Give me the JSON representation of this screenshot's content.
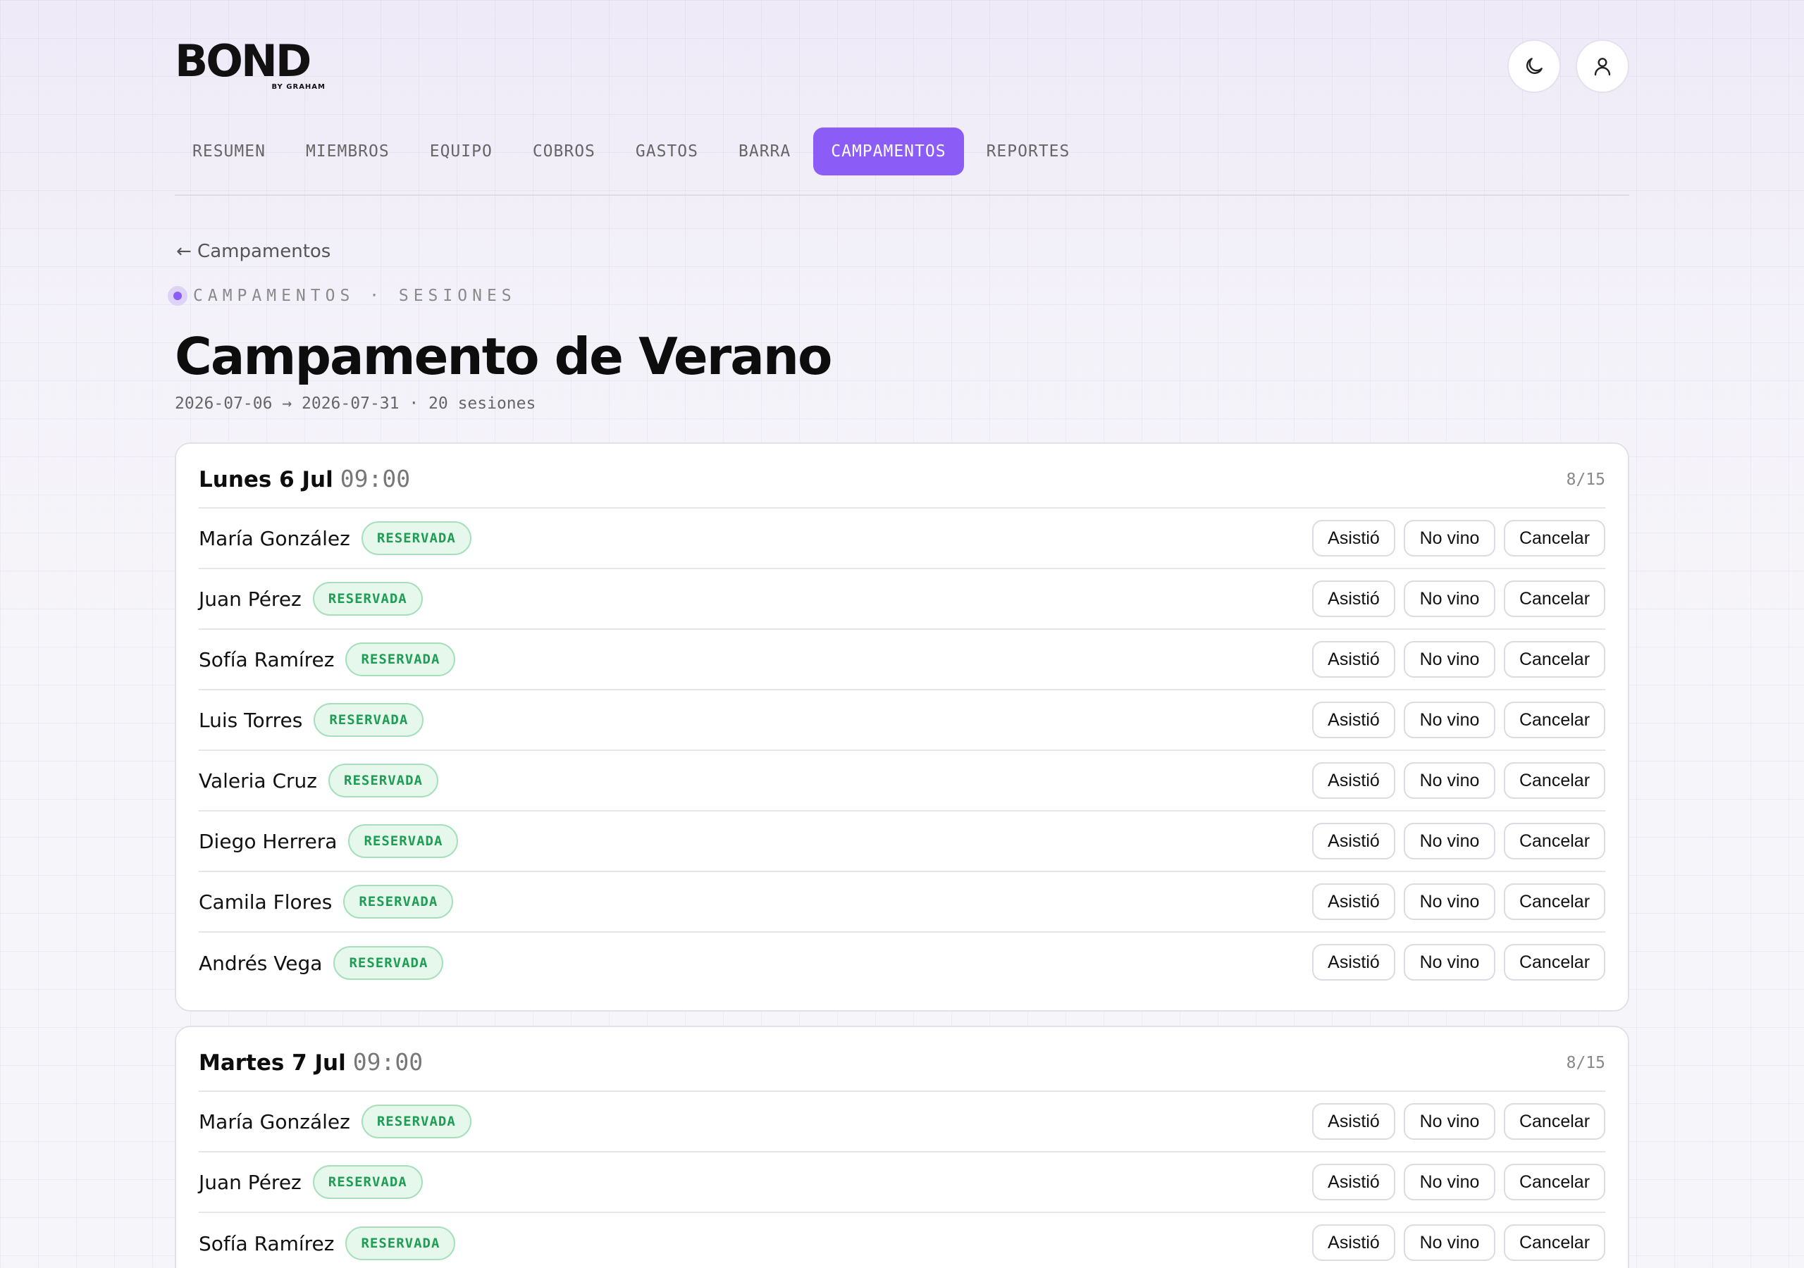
{
  "brand": {
    "logo_text": "BOND",
    "logo_sub": "BY GRAHAM"
  },
  "nav": {
    "tabs": [
      {
        "label": "RESUMEN",
        "active": false
      },
      {
        "label": "MIEMBROS",
        "active": false
      },
      {
        "label": "EQUIPO",
        "active": false
      },
      {
        "label": "COBROS",
        "active": false
      },
      {
        "label": "GASTOS",
        "active": false
      },
      {
        "label": "BARRA",
        "active": false
      },
      {
        "label": "CAMPAMENTOS",
        "active": true
      },
      {
        "label": "REPORTES",
        "active": false
      }
    ]
  },
  "header_icons": {
    "theme": "moon-icon",
    "user": "user-icon"
  },
  "page": {
    "back": "← Campamentos",
    "eyebrow": "CAMPAMENTOS · SESIONES",
    "title": "Campamento de Verano",
    "subtitle": "2026-07-06 → 2026-07-31 · 20 sesiones"
  },
  "actions": {
    "attended": "Asistió",
    "no_show": "No vino",
    "cancel": "Cancelar"
  },
  "colors": {
    "accent": "#8b5cf6",
    "badge_text": "#1f9d55",
    "badge_bg": "#e6f7ec"
  },
  "sessions": [
    {
      "day": "Lunes 6 Jul",
      "time": "09:00",
      "count": "8/15",
      "bookings": [
        {
          "name": "María González",
          "status": "RESERVADA"
        },
        {
          "name": "Juan Pérez",
          "status": "RESERVADA"
        },
        {
          "name": "Sofía Ramírez",
          "status": "RESERVADA"
        },
        {
          "name": "Luis Torres",
          "status": "RESERVADA"
        },
        {
          "name": "Valeria Cruz",
          "status": "RESERVADA"
        },
        {
          "name": "Diego Herrera",
          "status": "RESERVADA"
        },
        {
          "name": "Camila Flores",
          "status": "RESERVADA"
        },
        {
          "name": "Andrés Vega",
          "status": "RESERVADA"
        }
      ]
    },
    {
      "day": "Martes 7 Jul",
      "time": "09:00",
      "count": "8/15",
      "bookings": [
        {
          "name": "María González",
          "status": "RESERVADA"
        },
        {
          "name": "Juan Pérez",
          "status": "RESERVADA"
        },
        {
          "name": "Sofía Ramírez",
          "status": "RESERVADA"
        }
      ]
    }
  ]
}
